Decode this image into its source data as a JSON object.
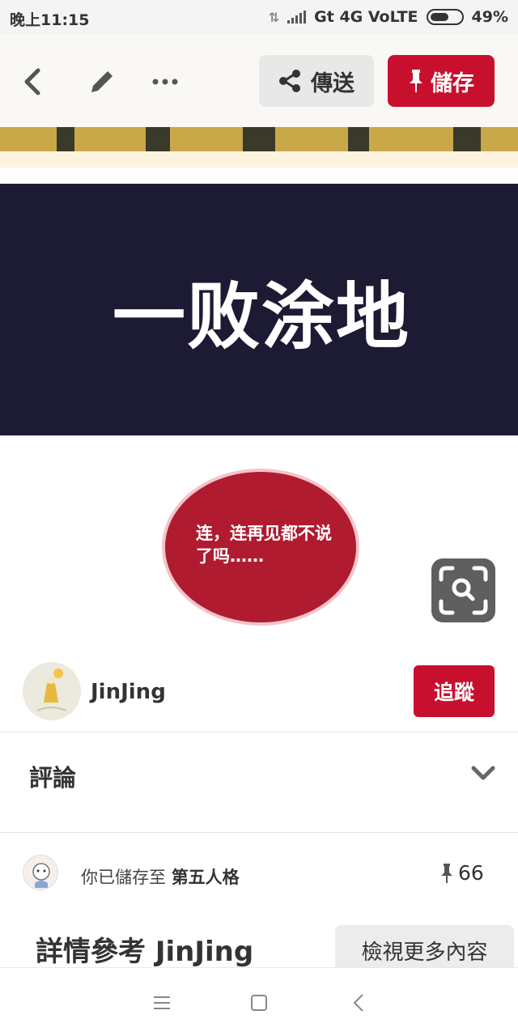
{
  "status_bar": {
    "time": "晚上11:15",
    "network": "Gt 4G VoLTE",
    "battery": "49%"
  },
  "toolbar": {
    "back_icon": "back-arrow-icon",
    "edit_icon": "pencil-icon",
    "more_icon": "more-dots-icon",
    "share_label": "傳送",
    "save_label": "儲存"
  },
  "pin_image": {
    "title_text": "一败涂地",
    "bubble_text": "连，连再见都不说了吗……"
  },
  "creator": {
    "name": "JinJing",
    "follow_label": "追蹤"
  },
  "comments": {
    "title": "評論"
  },
  "saved": {
    "prefix": "你已儲存至",
    "board": "第五人格",
    "pin_count": "66"
  },
  "details": {
    "title": "詳情參考 JinJing",
    "more_label": "檢視更多內容"
  },
  "colors": {
    "brand_red": "#c8102e",
    "banner_dark": "#1c1b33",
    "bubble_red": "#b01b30"
  }
}
